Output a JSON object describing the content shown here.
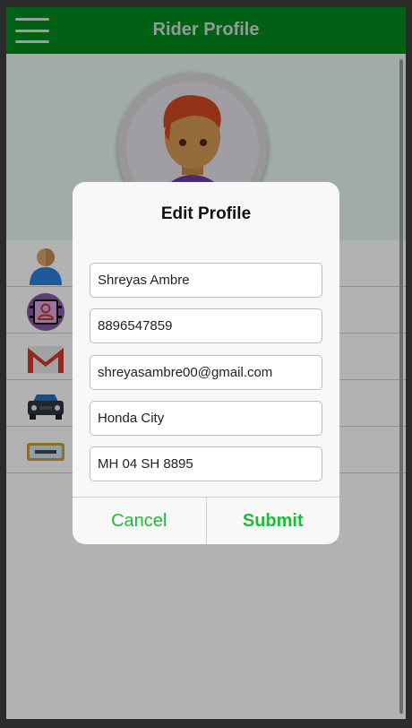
{
  "topbar": {
    "title": "Rider Profile",
    "menu_icon": "hamburger-menu-icon",
    "color": "#008a1e"
  },
  "profile": {
    "avatar_icon": "rider-avatar-icon",
    "rows": [
      {
        "icon": "person-icon"
      },
      {
        "icon": "contact-card-icon"
      },
      {
        "icon": "gmail-icon"
      },
      {
        "icon": "car-icon"
      },
      {
        "icon": "license-plate-icon"
      }
    ]
  },
  "modal": {
    "title": "Edit Profile",
    "fields": {
      "name": "Shreyas Ambre",
      "phone": "8896547859",
      "email": "shreyasambre00@gmail.com",
      "vehicle": "Honda City",
      "plate": "MH 04 SH 8895"
    },
    "cancel_label": "Cancel",
    "submit_label": "Submit",
    "accent": "#1fba3a"
  }
}
